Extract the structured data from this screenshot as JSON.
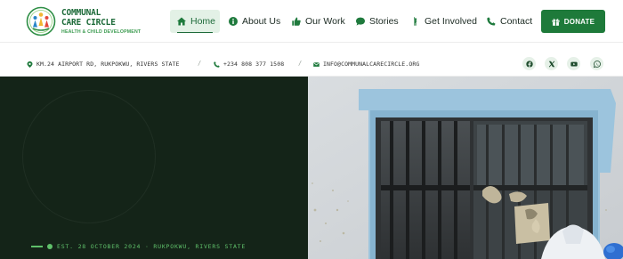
{
  "brand": {
    "line1": "COMMUNAL",
    "line2": "CARE CIRCLE",
    "tagline": "HEALTH & CHILD DEVELOPMENT",
    "logo_icon": "people-circle-logo-icon"
  },
  "nav": {
    "items": [
      {
        "label": "Home",
        "icon": "home-icon",
        "active": true
      },
      {
        "label": "About Us",
        "icon": "info-icon",
        "active": false
      },
      {
        "label": "Our Work",
        "icon": "thumbs-up-icon",
        "active": false
      },
      {
        "label": "Stories",
        "icon": "chat-bubble-icon",
        "active": false
      },
      {
        "label": "Get Involved",
        "icon": "person-raise-hand-icon",
        "active": false
      },
      {
        "label": "Contact",
        "icon": "phone-icon",
        "active": false
      }
    ],
    "donate_label": "DONATE",
    "donate_icon": "gift-icon"
  },
  "infobar": {
    "address": "KM.24 AIRPORT RD, RUKPOKWU, RIVERS STATE",
    "phone": "+234 808 377 1508",
    "email": "INFO@COMMUNALCARECIRCLE.ORG",
    "separator": "/",
    "social": [
      "facebook-icon",
      "x-icon",
      "youtube-icon",
      "whatsapp-icon"
    ]
  },
  "hero": {
    "established": "EST. 28 OCTOBER 2024 · RUKPOKWU, RIVERS STATE"
  },
  "colors": {
    "brand_green": "#1e7a3a",
    "hero_dark": "#142418",
    "accent_green": "#5fc06a",
    "nav_active_bg": "#e3f1e6"
  }
}
